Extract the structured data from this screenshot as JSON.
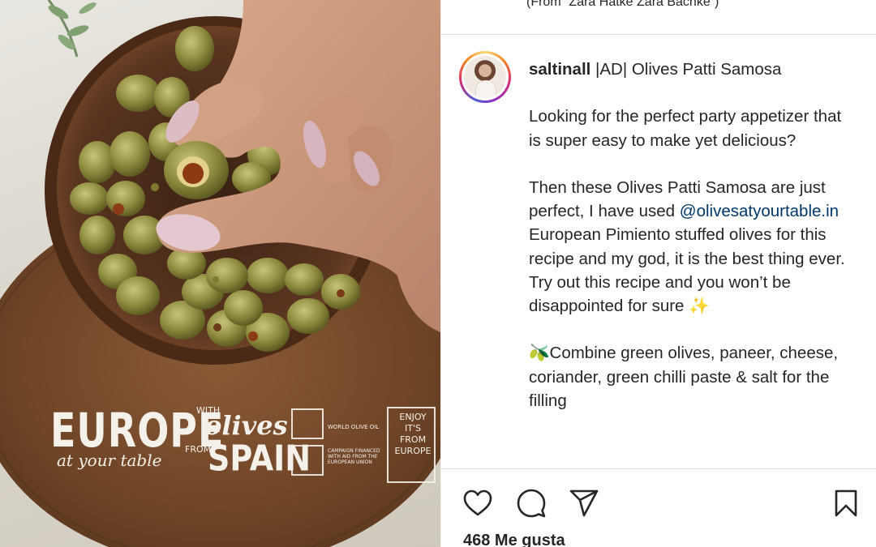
{
  "photo": {
    "brand_line1": "EUROPE",
    "brand_line2": "at your table",
    "with": "WITH",
    "olives": "olives",
    "from": "FROM",
    "spain": "SPAIN",
    "badge1": "WORLD OLIVE OIL",
    "badge2": "CAMPAIGN FINANCED WITH AID FROM THE EUROPEAN UNION",
    "enjoy": "ENJOY IT'S FROM EUROPE"
  },
  "post": {
    "previous_caption": "(From “Zara Hatke Zara Bachke”)",
    "username": "saltinall",
    "title": " |AD| Olives Patti Samosa",
    "paragraph1": "Looking for the perfect party appetizer that is super easy to make yet delicious?",
    "paragraph2_before": "Then these Olives Patti Samosa are just perfect, I have used ",
    "mention": "@olivesatyourtable.in",
    "paragraph2_after": " European Pimiento stuffed olives for this recipe and my god, it is the best thing ever. Try out this recipe and you won’t be disappointed for sure ✨",
    "step1": "🫒Combine green olives, paneer, cheese, coriander, green chilli paste & salt for the filling"
  },
  "actions": {
    "like_icon": "heart-icon",
    "comment_icon": "comment-icon",
    "share_icon": "paper-plane-icon",
    "save_icon": "bookmark-icon",
    "likes": "468 Me gusta"
  },
  "colors": {
    "mention": "#00376b",
    "text": "#262626",
    "divider": "#dbdbdb"
  }
}
